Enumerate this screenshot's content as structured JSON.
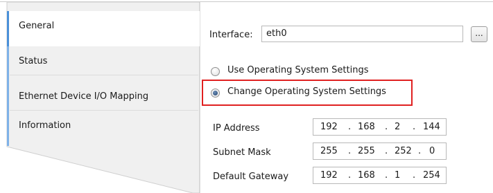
{
  "tabs": [
    {
      "label": "General",
      "active": true
    },
    {
      "label": "Status",
      "active": false
    },
    {
      "label": "Ethernet Device I/O Mapping",
      "active": false
    },
    {
      "label": "Information",
      "active": false
    }
  ],
  "interface": {
    "label": "Interface:",
    "value": "eth0",
    "browse_label": "..."
  },
  "os_settings": {
    "use_label": "Use Operating System Settings",
    "change_label": "Change Operating System Settings",
    "selected": "change"
  },
  "network": {
    "ip_label": "IP Address",
    "ip": [
      "192",
      "168",
      "2",
      "144"
    ],
    "subnet_label": "Subnet Mask",
    "subnet": [
      "255",
      "255",
      "252",
      "0"
    ],
    "gateway_label": "Default Gateway",
    "gateway": [
      "192",
      "168",
      "1",
      "254"
    ],
    "dot": "."
  },
  "colors": {
    "accent": "#4a90d9",
    "highlight": "#e02020"
  }
}
